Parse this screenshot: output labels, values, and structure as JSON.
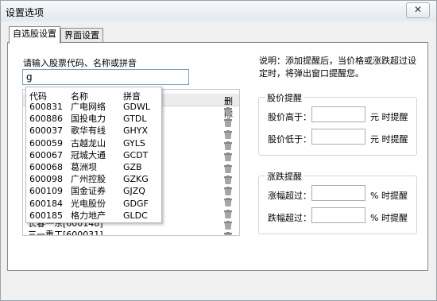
{
  "window": {
    "title": "设置选项",
    "close_label": "✕"
  },
  "tabs": [
    {
      "label": "自选股设置",
      "active": true
    },
    {
      "label": "界面设置",
      "active": false
    }
  ],
  "search": {
    "prompt": "请输入股票代码、名称或拼音",
    "value": "g"
  },
  "stock_list": {
    "delete_header": "删除",
    "visible_rows_below_dropdown": [
      "长春一东[600148]",
      "三一重工[600031]"
    ]
  },
  "dropdown": {
    "headers": {
      "code": "代码",
      "name": "名称",
      "pinyin": "拼音"
    },
    "rows": [
      {
        "code": "600831",
        "name": "广电网络",
        "pinyin": "GDWL"
      },
      {
        "code": "600886",
        "name": "国投电力",
        "pinyin": "GTDL"
      },
      {
        "code": "600037",
        "name": "歌华有线",
        "pinyin": "GHYX"
      },
      {
        "code": "600059",
        "name": "古越龙山",
        "pinyin": "GYLS"
      },
      {
        "code": "600067",
        "name": "冠城大通",
        "pinyin": "GCDT"
      },
      {
        "code": "600068",
        "name": "葛洲坝",
        "pinyin": "GZB"
      },
      {
        "code": "600098",
        "name": "广州控股",
        "pinyin": "GZKG"
      },
      {
        "code": "600109",
        "name": "国金证券",
        "pinyin": "GJZQ"
      },
      {
        "code": "600184",
        "name": "光电股份",
        "pinyin": "GDGF"
      },
      {
        "code": "600185",
        "name": "格力地产",
        "pinyin": "GLDC"
      }
    ]
  },
  "description": "说明：添加提醒后，当价格或涨跌超过设定时，将弹出窗口提醒您。",
  "price_alert": {
    "title": "股价提醒",
    "high_label": "股价高于：",
    "high_value": "",
    "high_unit": "元 时提醒",
    "low_label": "股价低于：",
    "low_value": "",
    "low_unit": "元 时提醒"
  },
  "change_alert": {
    "title": "涨跌提醒",
    "up_label": "涨幅超过：",
    "up_value": "",
    "up_unit": "% 时提醒",
    "down_label": "跌幅超过：",
    "down_value": "",
    "down_unit": "% 时提醒"
  }
}
